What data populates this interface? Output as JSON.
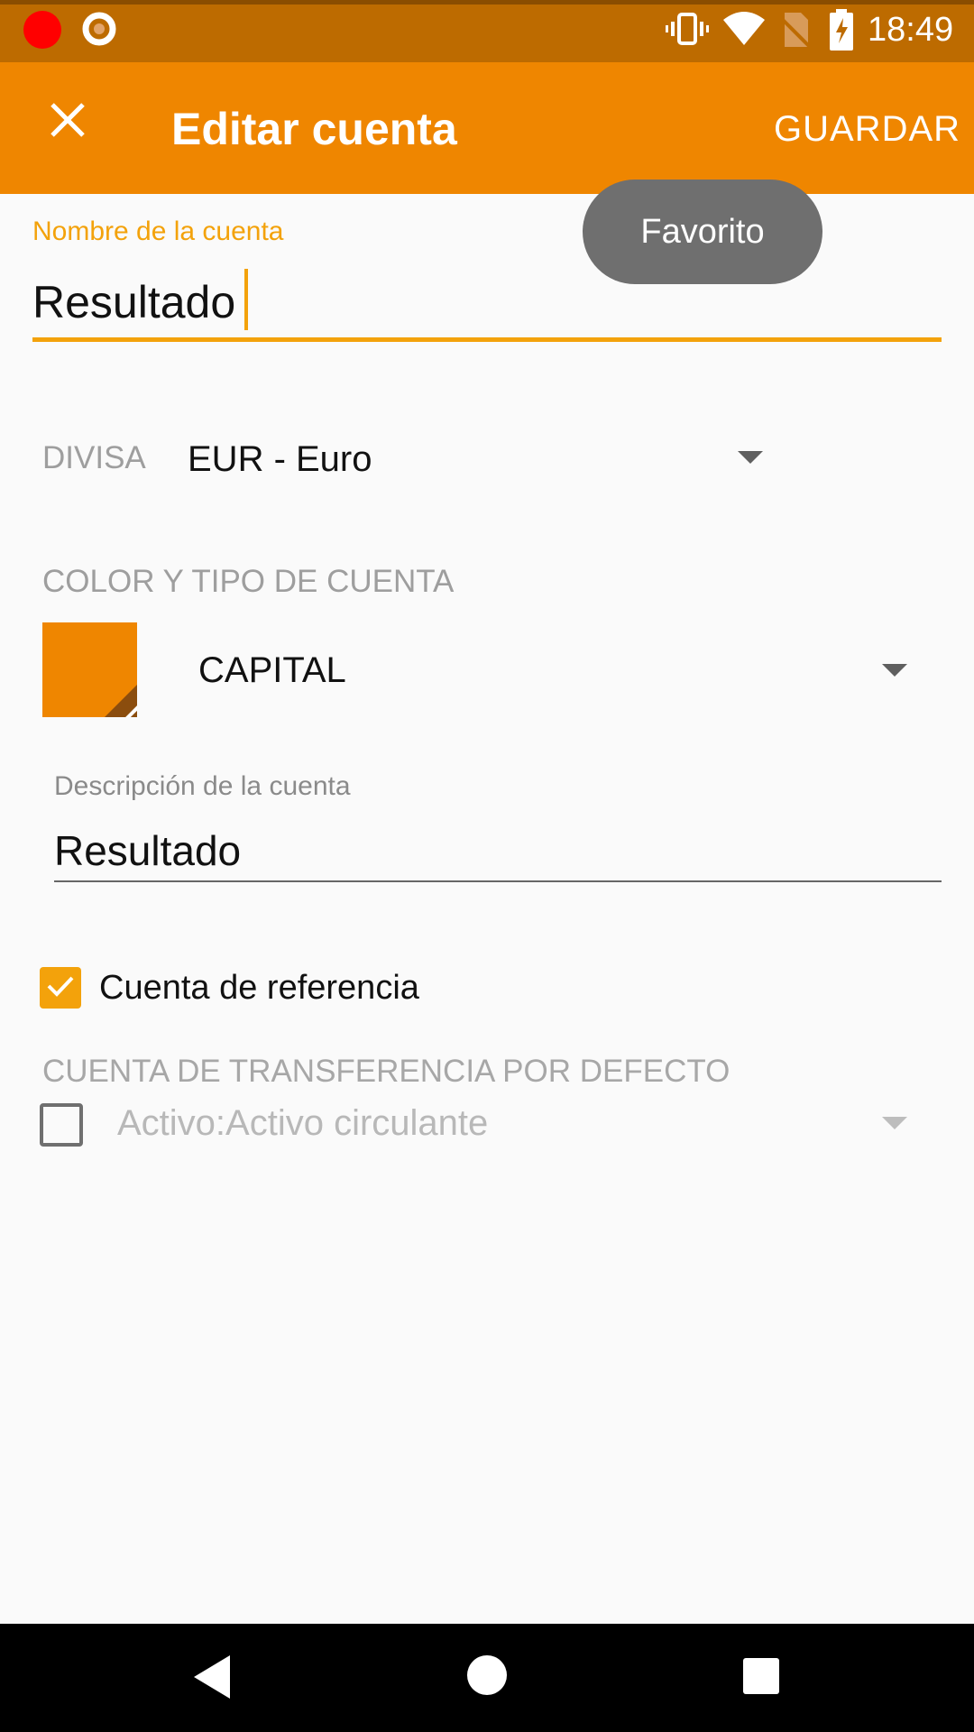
{
  "status_bar": {
    "time": "18:49",
    "icons": [
      "record-icon",
      "target-icon",
      "vibrate-icon",
      "wifi-icon",
      "no-sim-icon",
      "battery-charging-icon"
    ],
    "colors": {
      "background": "#bd6b00",
      "record": "#ff0000"
    }
  },
  "app_bar": {
    "title": "Editar cuenta",
    "close_icon": "close-icon",
    "save_label": "GUARDAR",
    "background": "#ef8600"
  },
  "tooltip": {
    "text": "Favorito"
  },
  "form": {
    "account_name": {
      "label": "Nombre de la cuenta",
      "value": "Resultado",
      "accent": "#f3a20b"
    },
    "currency": {
      "label": "DIVISA",
      "value": "EUR - Euro"
    },
    "color_type": {
      "label": "COLOR Y TIPO DE CUENTA",
      "color": "#ef8600",
      "type_value": "CAPITAL"
    },
    "description": {
      "label": "Descripción de la cuenta",
      "value": "Resultado"
    },
    "reference_account": {
      "label": "Cuenta de referencia",
      "checked": true
    },
    "default_transfer": {
      "label": "CUENTA DE TRANSFERENCIA POR DEFECTO",
      "checked": false,
      "value": "Activo:Activo circulante"
    }
  },
  "nav_bar": {
    "icons": [
      "back-icon",
      "home-icon",
      "recent-apps-icon"
    ]
  }
}
